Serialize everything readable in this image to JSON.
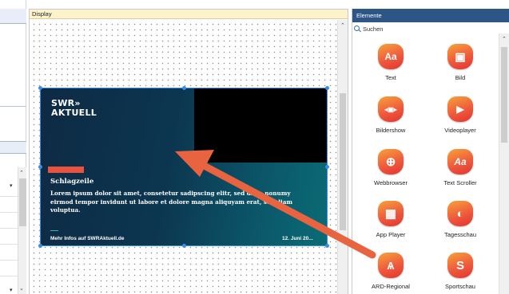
{
  "display": {
    "title": "Display",
    "slide": {
      "logo_line1": "SWR»",
      "logo_line2": "AKTUELL",
      "headline": "Schlagzeile",
      "body": "Lorem ipsum dolor sit amet, consetetur sadipscing elitr, sed diam nonumy eirmod tempor invidunt ut labore et dolore magna aliquyam erat, sed diam voluptua.",
      "more": "Mehr Infos auf SWRAktuell.de",
      "date": "12. Juni 20..."
    }
  },
  "elemente": {
    "title": "Elemente",
    "search_placeholder": "Suchen",
    "items": [
      {
        "label": "Text",
        "icon": "text-icon",
        "glyph": "Aa"
      },
      {
        "label": "Bild",
        "icon": "image-icon",
        "glyph": "▣"
      },
      {
        "label": "Bildershow",
        "icon": "slideshow-icon",
        "glyph": "◂▣▸"
      },
      {
        "label": "Videoplayer",
        "icon": "video-camera-icon",
        "glyph": "▶"
      },
      {
        "label": "Webbrowser",
        "icon": "globe-icon",
        "glyph": "⊕"
      },
      {
        "label": "Text Scroller",
        "icon": "text-scroller-icon",
        "glyph": "Aa"
      },
      {
        "label": "App Player",
        "icon": "app-grid-icon",
        "glyph": "▦"
      },
      {
        "label": "Tagesschau",
        "icon": "tagesschau-icon",
        "glyph": "◐"
      },
      {
        "label": "ARD-Regional",
        "icon": "antenna-icon",
        "glyph": "Ѧ"
      },
      {
        "label": "Sportschau",
        "icon": "sportschau-icon",
        "glyph": "S"
      }
    ]
  },
  "colors": {
    "accent_red": "#e8533f",
    "header_blue": "#2d5586",
    "display_header": "#fcf3cc",
    "slide_dark": "#0e2a44",
    "slide_teal": "#0a6c75",
    "selection_blue": "#3a8ee6",
    "arrow": "#e8633f"
  }
}
